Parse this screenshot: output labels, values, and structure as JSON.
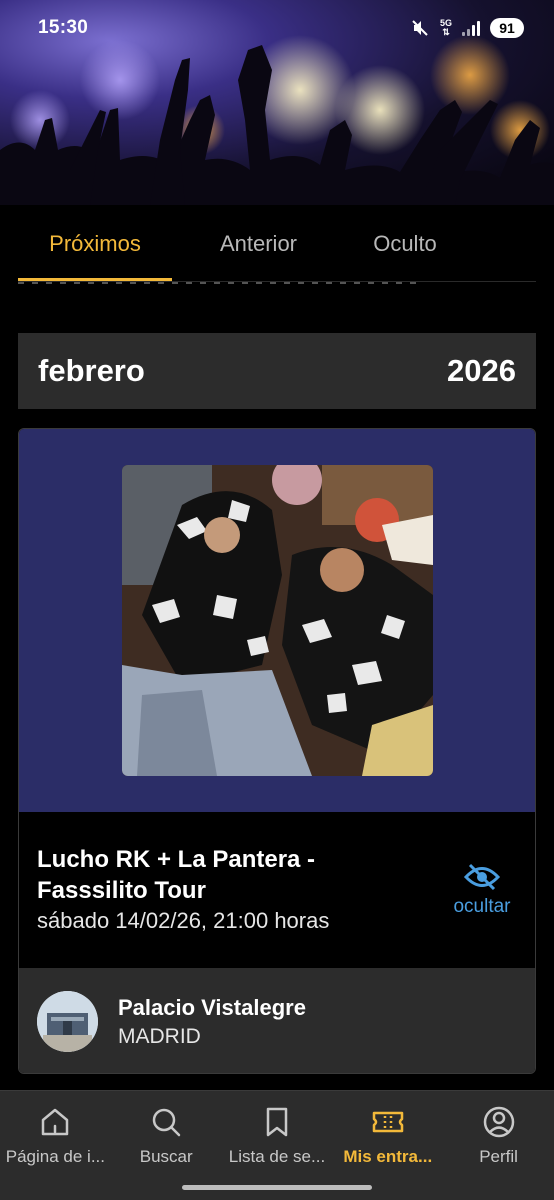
{
  "status_bar": {
    "time": "15:30",
    "network": "5G",
    "battery": "91",
    "icons": [
      "mute-icon",
      "signal-icon",
      "battery-icon"
    ]
  },
  "tabs": [
    {
      "label": "Próximos",
      "active": true
    },
    {
      "label": "Anterior",
      "active": false
    },
    {
      "label": "Oculto",
      "active": false
    }
  ],
  "month_header": {
    "month": "febrero",
    "year": "2026"
  },
  "event": {
    "title": "Lucho RK + La Pantera - Fasssilito Tour",
    "datetime": "sábado 14/02/26, 21:00 horas",
    "hide_label": "ocultar",
    "venue": {
      "name": "Palacio Vistalegre",
      "city": "MADRID"
    }
  },
  "bottom_nav": [
    {
      "label": "Página de i...",
      "icon": "home-icon",
      "active": false
    },
    {
      "label": "Buscar",
      "icon": "search-icon",
      "active": false
    },
    {
      "label": "Lista de se...",
      "icon": "bookmark-icon",
      "active": false
    },
    {
      "label": "Mis entra...",
      "icon": "ticket-icon",
      "active": true
    },
    {
      "label": "Perfil",
      "icon": "profile-icon",
      "active": false
    }
  ],
  "colors": {
    "accent": "#f3b93a",
    "link": "#4a9ee0",
    "card_art_bg": "#2b2d67",
    "surface": "#2c2c2c"
  }
}
